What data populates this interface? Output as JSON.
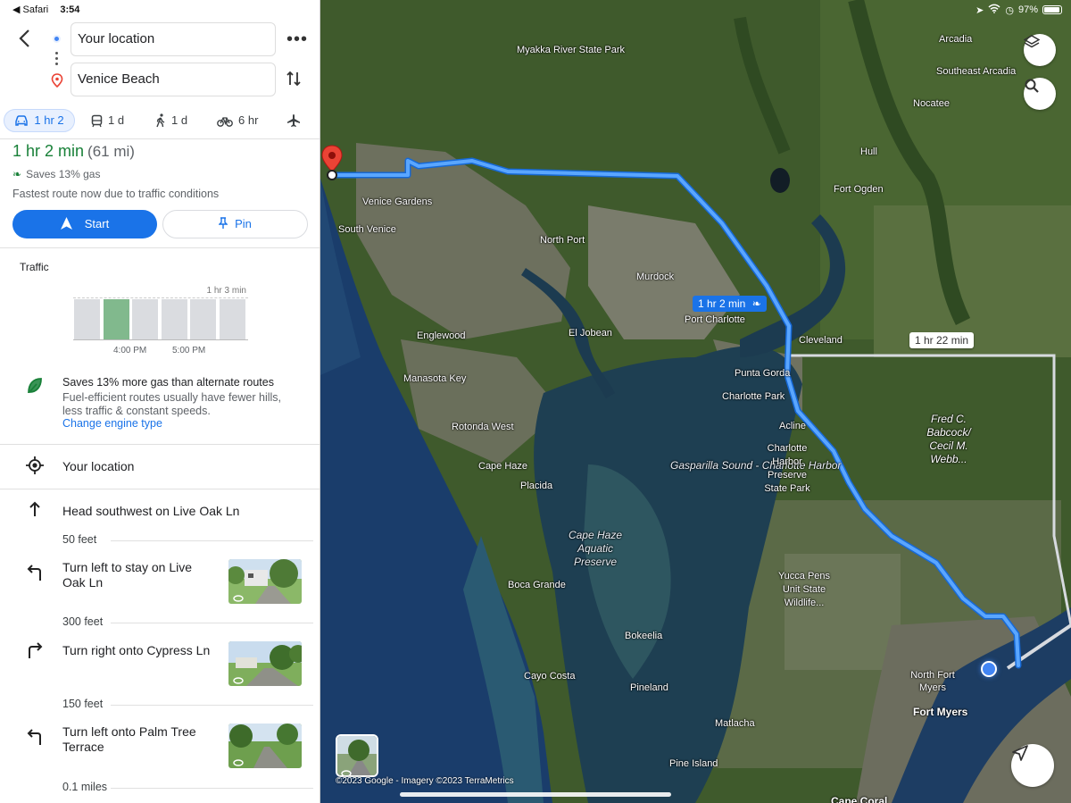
{
  "status_bar": {
    "app_back": "◀ Safari",
    "time": "3:54",
    "battery": "97%"
  },
  "search": {
    "from": "Your location",
    "to": "Venice Beach"
  },
  "modes": [
    {
      "icon": "car-icon",
      "label": "1 hr 2",
      "active": true
    },
    {
      "icon": "transit-icon",
      "label": "1 d",
      "active": false
    },
    {
      "icon": "walk-icon",
      "label": "1 d",
      "active": false
    },
    {
      "icon": "bike-icon",
      "label": "6 hr",
      "active": false
    },
    {
      "icon": "plane-icon",
      "label": "",
      "active": false
    }
  ],
  "summary": {
    "time": "1 hr 2 min",
    "distance": "(61 mi)",
    "saves_gas": "Saves 13% gas",
    "note": "Fastest route now due to traffic conditions",
    "start_label": "Start",
    "pin_label": "Pin"
  },
  "traffic": {
    "title": "Traffic",
    "max_label": "1 hr 3 min",
    "tick_labels": [
      "4:00 PM",
      "5:00 PM"
    ],
    "bar_levels": [
      0.95,
      0.95,
      0.95,
      0.95,
      0.95,
      0.95
    ],
    "highlight_index": 1
  },
  "eco": {
    "title": "Saves 13% more gas than alternate routes",
    "desc": "Fuel-efficient routes usually have fewer hills, less traffic & constant speeds.",
    "link": "Change engine type"
  },
  "steps": {
    "start": "Your location",
    "s1": "Head southwest on Live Oak Ln",
    "d1": "50 feet",
    "s2": "Turn left to stay on Live Oak Ln",
    "d2": "300 feet",
    "s3": "Turn right onto Cypress Ln",
    "d3": "150 feet",
    "s4": "Turn left onto Palm Tree Terrace",
    "d4": "0.1 miles"
  },
  "map": {
    "route_label": "1 hr 2 min",
    "alt_label": "1 hr 22 min",
    "attribution": "©2023 Google - Imagery ©2023 TerraMetrics",
    "labels": {
      "myakka": "Myakka River State Park",
      "arcadia": "Arcadia",
      "se_arcadia": "Southeast Arcadia",
      "nocatee": "Nocatee",
      "hull": "Hull",
      "fort_ogden": "Fort Ogden",
      "venice_gardens": "Venice Gardens",
      "south_venice": "South Venice",
      "north_port": "North Port",
      "murdock": "Murdock",
      "port_charlotte": "Port Charlotte",
      "el_jobean": "El Jobean",
      "englewood": "Englewood",
      "cleveland": "Cleveland",
      "punta_gorda": "Punta Gorda",
      "charlotte_park": "Charlotte Park",
      "manasota_key": "Manasota Key",
      "acline": "Acline",
      "rotonda_west": "Rotonda West",
      "cape_haze": "Cape Haze",
      "placida": "Placida",
      "gasparilla": "Gasparilla Sound - Charlotte Harbor",
      "charlotte_harbor_preserve": "Charlotte Harbor Preserve State Park",
      "babcock": "Fred C. Babcock/ Cecil M. Webb...",
      "cape_haze_preserve": "Cape Haze Aquatic Preserve",
      "boca_grande": "Boca Grande",
      "yucca_pens": "Yucca Pens Unit State Wildlife...",
      "bokeelia": "Bokeelia",
      "cayo_costa": "Cayo Costa",
      "pineland": "Pineland",
      "north_fort_myers": "North Fort Myers",
      "fort_myers": "Fort Myers",
      "matlacha": "Matlacha",
      "pine_island": "Pine Island",
      "cape_coral": "Cape Coral"
    }
  }
}
